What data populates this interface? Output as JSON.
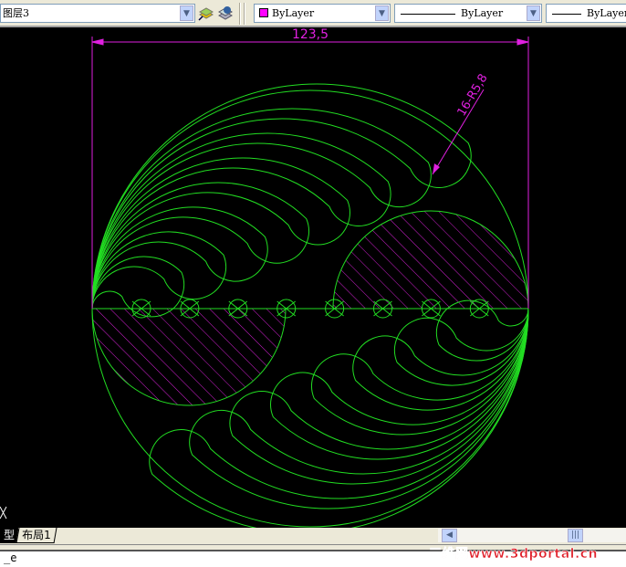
{
  "toolbar": {
    "layer": "图层3",
    "color": "ByLayer",
    "linetype": "ByLayer",
    "lineweight": "ByLayer"
  },
  "drawing": {
    "dimension_width": "123,5",
    "dimension_radius": "16-R5,8",
    "small_circle_count": 8
  },
  "tabs": {
    "model": "型",
    "layout1": "布局1"
  },
  "command": {
    "text": "_e"
  },
  "watermark": "三维网www.3dportal.cn",
  "colors": {
    "geometry": "#22dd22",
    "dimension": "#e020e0",
    "hatch": "#d020d0",
    "background": "#000000"
  }
}
